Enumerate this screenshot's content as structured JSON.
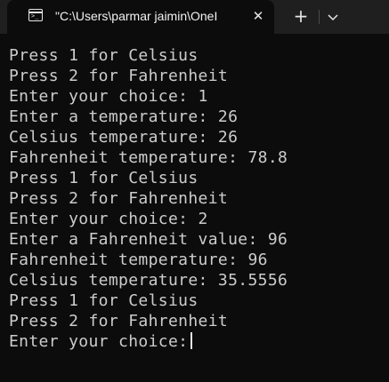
{
  "tab": {
    "title": "\"C:\\Users\\parmar jaimin\\OneI",
    "close_glyph": "✕",
    "new_tab_glyph": "+"
  },
  "icons": {
    "tab_icon": "terminal-icon",
    "close": "close-icon",
    "new_tab": "plus-icon",
    "dropdown": "chevron-down-icon"
  },
  "terminal": {
    "lines": [
      "Press 1 for Celsius",
      "Press 2 for Fahrenheit",
      "Enter your choice: 1",
      "Enter a temperature: 26",
      "Celsius temperature: 26",
      "Fahrenheit temperature: 78.8",
      "Press 1 for Celsius",
      "Press 2 for Fahrenheit",
      "Enter your choice: 2",
      "Enter a Fahrenheit value: 96",
      "Fahrenheit temperature: 96",
      "Celsius temperature: 35.5556",
      "Press 1 for Celsius",
      "Press 2 for Fahrenheit",
      "Enter your choice:"
    ]
  },
  "colors": {
    "background": "#0c0c0c",
    "titlebar": "#1f1f1f",
    "text": "#cccccc"
  }
}
